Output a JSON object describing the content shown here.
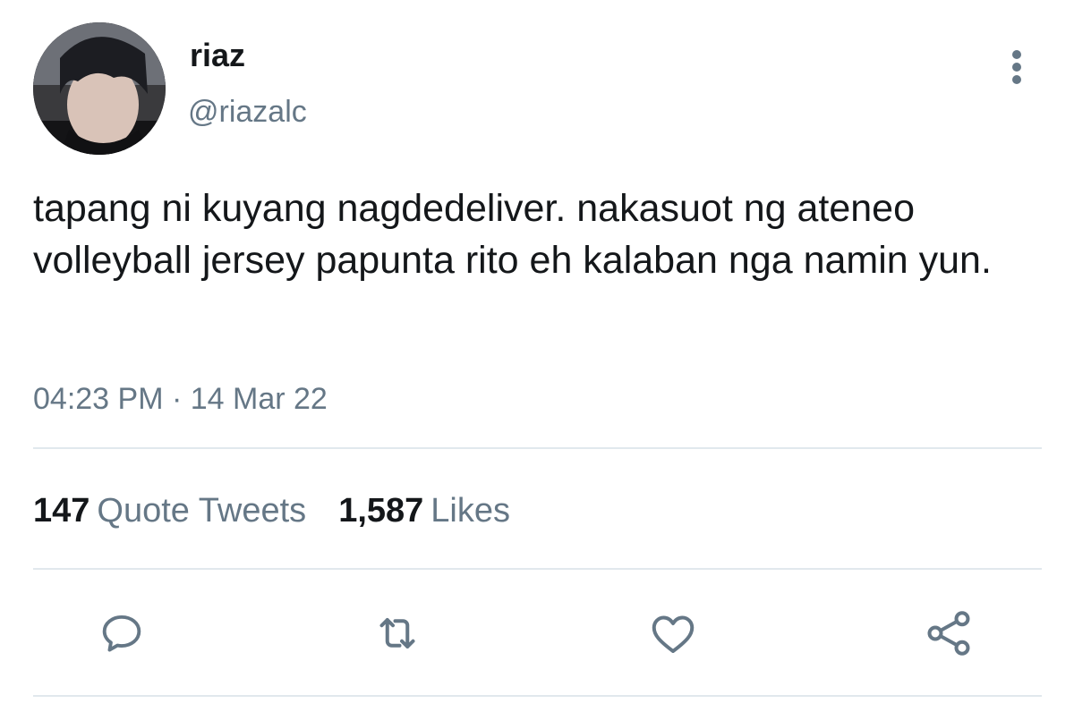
{
  "tweet": {
    "display_name": "riaz",
    "handle": "@riazalc",
    "text": "tapang ni kuyang nagdedeliver. nakasuot ng ateneo volleyball jersey papunta rito eh kalaban nga namin yun.",
    "timestamp": "04:23 PM · 14 Mar 22"
  },
  "stats": {
    "quote_tweets_count": "147",
    "quote_tweets_label": "Quote Tweets",
    "likes_count": "1,587",
    "likes_label": "Likes"
  },
  "icons": {
    "more": "more-vertical-icon",
    "reply": "reply-icon",
    "retweet": "retweet-icon",
    "like": "heart-icon",
    "share": "share-icon"
  },
  "colors": {
    "primary_text": "#14171a",
    "secondary_text": "#657786",
    "divider": "#e1e8ed"
  }
}
